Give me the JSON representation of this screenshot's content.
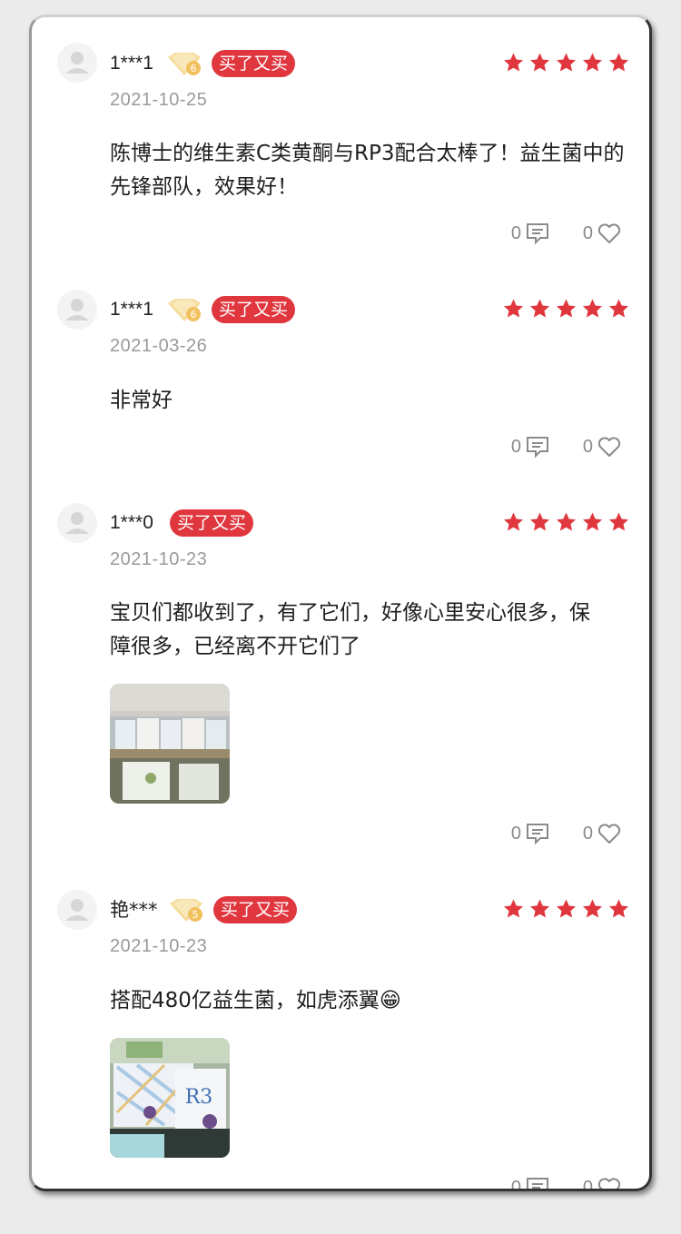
{
  "colors": {
    "accent": "#e0373f",
    "star": "#e0373f",
    "muted": "#9a9a9a"
  },
  "reviews": [
    {
      "username": "1***1",
      "vip_level": "6",
      "badge": "买了又买",
      "rating": 5,
      "date": "2021-10-25",
      "content": "陈博士的维生素C类黄酮与RP3配合太棒了！益生菌中的先锋部队，效果好！",
      "comment_count": "0",
      "like_count": "0"
    },
    {
      "username": "1***1",
      "vip_level": "6",
      "badge": "买了又买",
      "rating": 5,
      "date": "2021-03-26",
      "content": "非常好",
      "comment_count": "0",
      "like_count": "0"
    },
    {
      "username": "1***0",
      "badge": "买了又买",
      "rating": 5,
      "date": "2021-10-23",
      "content": "宝贝们都收到了，有了它们，好像心里安心很多，保障很多，已经离不开它们了",
      "comment_count": "0",
      "like_count": "0"
    },
    {
      "username": "艳***",
      "vip_level": "5",
      "badge": "买了又买",
      "rating": 5,
      "date": "2021-10-23",
      "content": "搭配480亿益生菌，如虎添翼😁",
      "comment_count": "0",
      "like_count": "0"
    }
  ]
}
